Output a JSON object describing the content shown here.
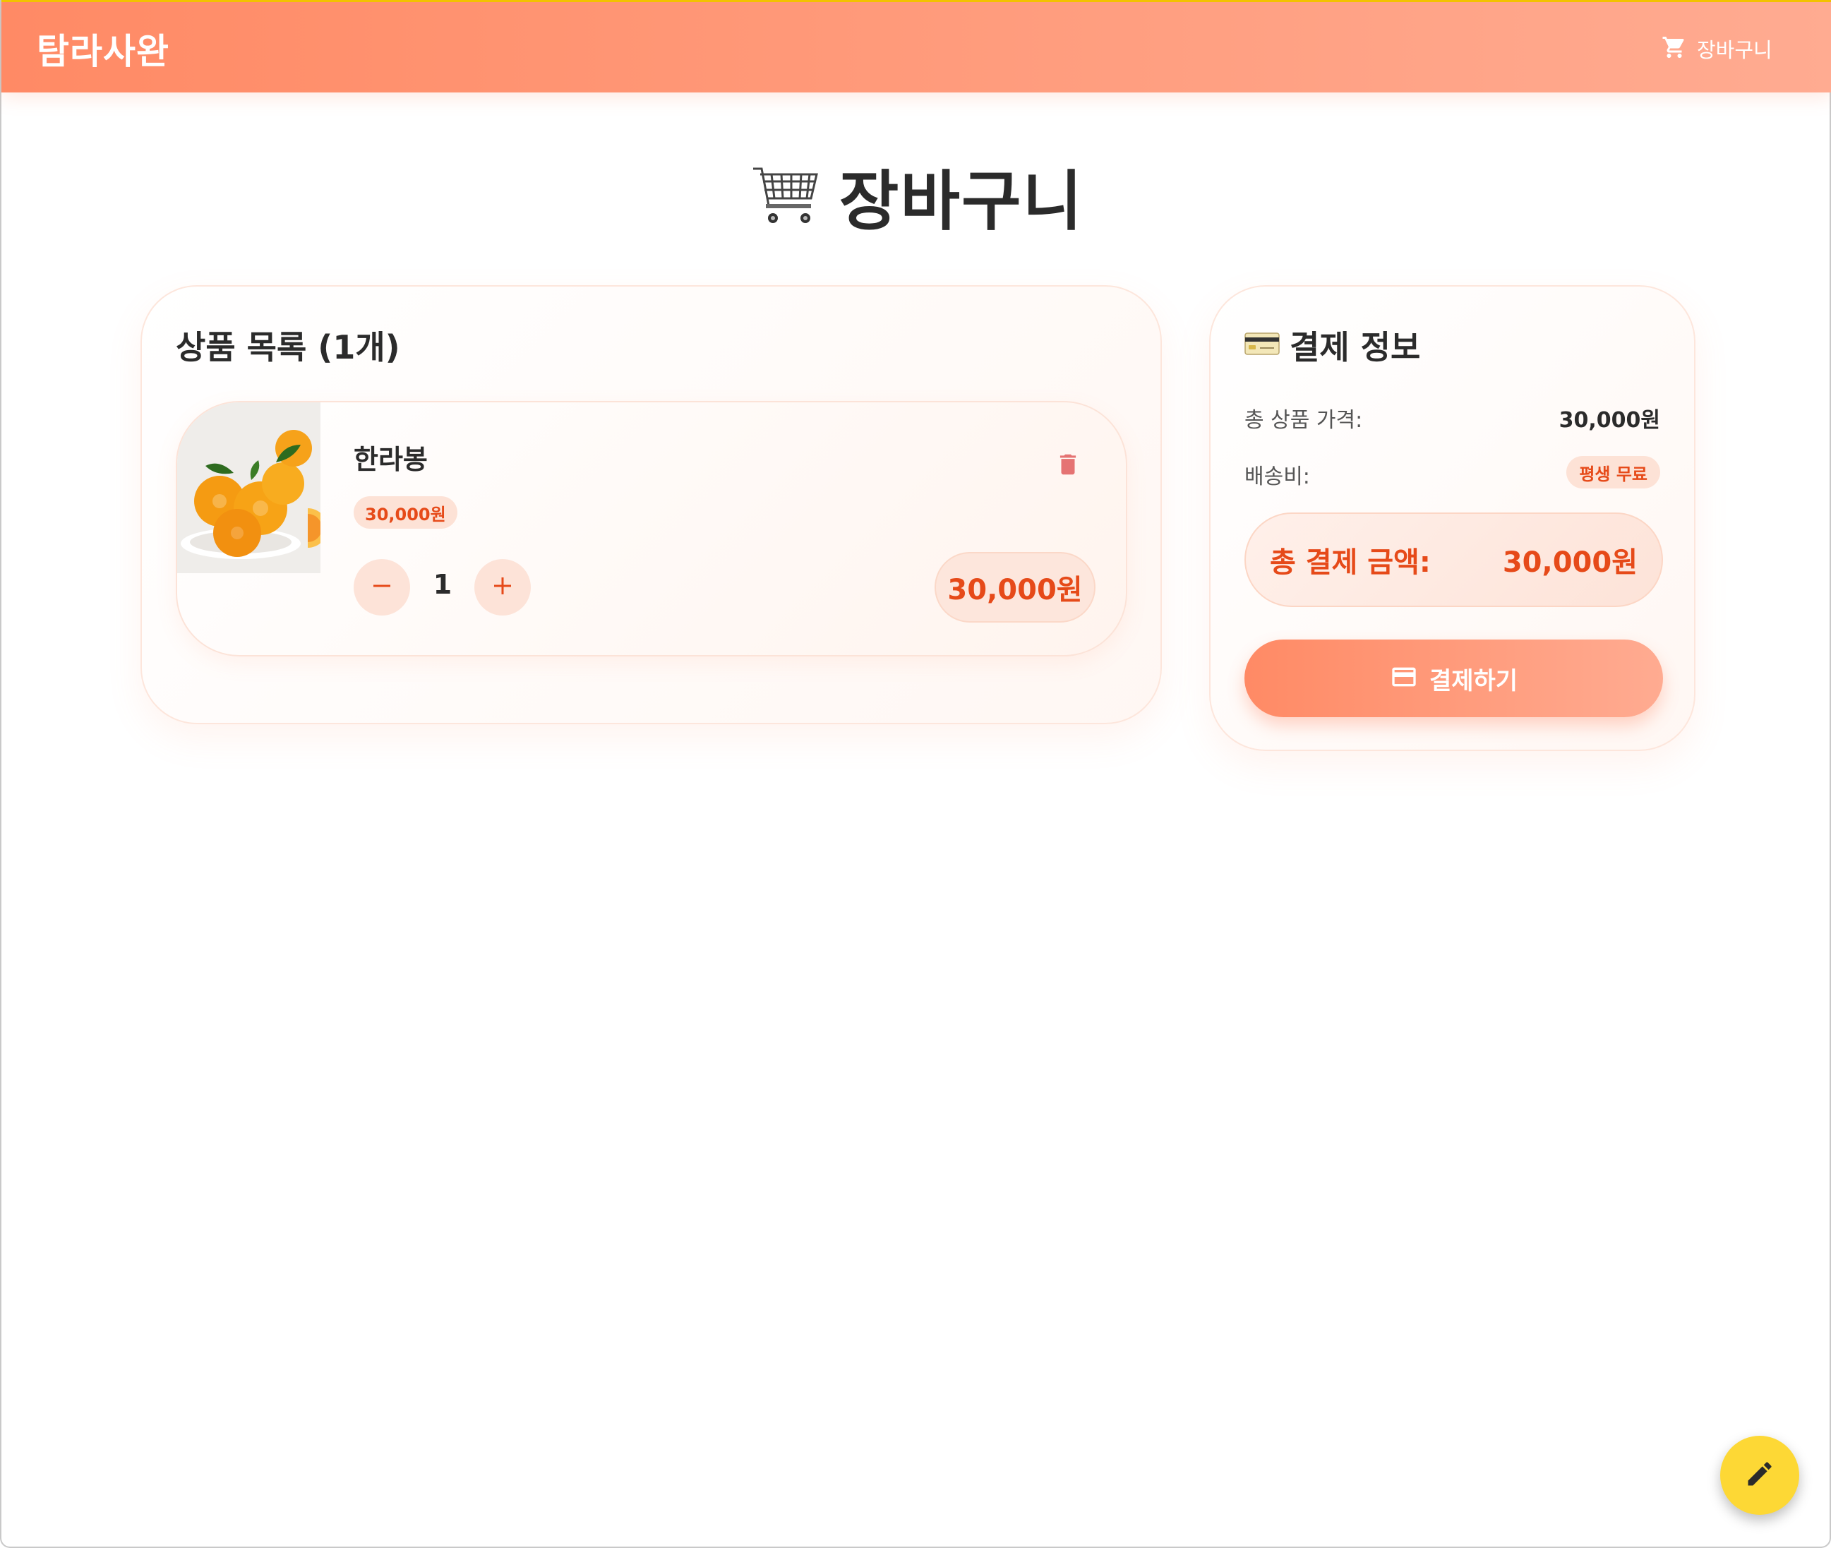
{
  "header": {
    "brand": "탐라사완",
    "nav_cart_label": "장바구니",
    "nav_cart_icon": "shopping-cart-icon"
  },
  "page": {
    "title": "장바구니",
    "title_icon": "shopping-cart-icon"
  },
  "cart_list": {
    "title": "상품 목록 (1개)",
    "items": [
      {
        "name": "한라봉",
        "unit_price": "30,000원",
        "quantity": "1",
        "line_total": "30,000원",
        "image": "hallabong-oranges-photo",
        "delete_icon": "trash-icon",
        "minus_icon": "minus-icon",
        "plus_icon": "plus-icon"
      }
    ]
  },
  "payment": {
    "title": "결제 정보",
    "title_icon": "credit-card-icon",
    "subtotal_label": "총 상품 가격:",
    "subtotal_value": "30,000원",
    "shipping_label": "배송비:",
    "shipping_value": "평생 무료",
    "total_label": "총 결제 금액:",
    "total_value": "30,000원",
    "checkout_label": "결제하기",
    "checkout_icon": "credit-card-icon"
  },
  "fab": {
    "icon": "pencil-icon"
  },
  "colors": {
    "accent": "#ff8a65",
    "accent_light": "#ffab91",
    "price_red": "#e64a19",
    "badge_bg": "#fde2d6",
    "fab_yellow": "#fdd835",
    "delete_red": "#e57373"
  }
}
